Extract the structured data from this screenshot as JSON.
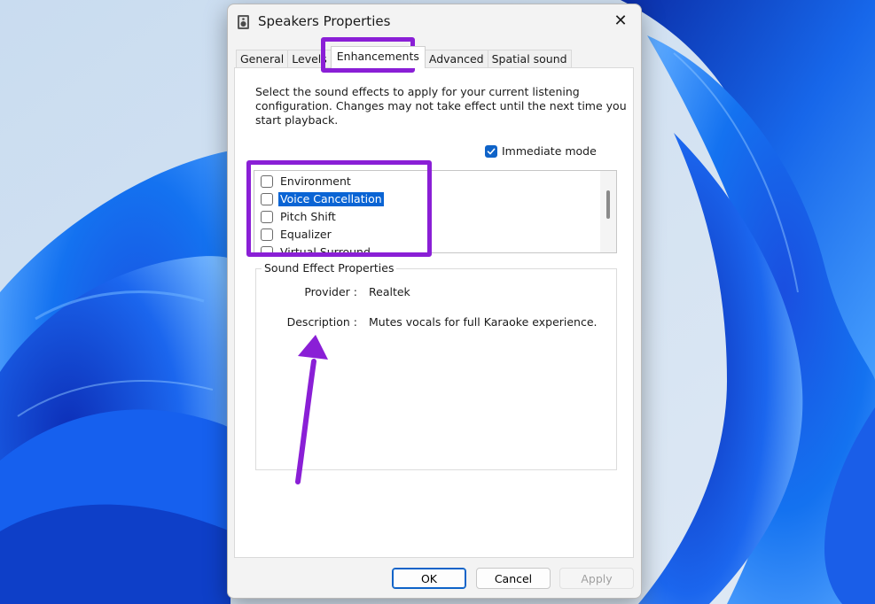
{
  "window": {
    "title": "Speakers Properties",
    "close_glyph": "✕"
  },
  "tabs": [
    {
      "label": "General",
      "active": false
    },
    {
      "label": "Levels",
      "active": false
    },
    {
      "label": "Enhancements",
      "active": true
    },
    {
      "label": "Advanced",
      "active": false
    },
    {
      "label": "Spatial sound",
      "active": false
    }
  ],
  "enhancements": {
    "intro_text": "Select the sound effects to apply for your current listening configuration. Changes may not take effect until the next time you start playback.",
    "immediate_mode": {
      "label": "Immediate mode",
      "checked": true
    },
    "effects": [
      {
        "label": "Environment",
        "checked": false,
        "selected": false
      },
      {
        "label": "Voice Cancellation",
        "checked": false,
        "selected": true
      },
      {
        "label": "Pitch Shift",
        "checked": false,
        "selected": false
      },
      {
        "label": "Equalizer",
        "checked": false,
        "selected": false
      },
      {
        "label": "Virtual Surround",
        "checked": false,
        "selected": false
      }
    ],
    "properties": {
      "group_title": "Sound Effect Properties",
      "provider_label": "Provider :",
      "provider_value": "Realtek",
      "description_label": "Description :",
      "description_value": "Mutes vocals for full Karaoke experience."
    }
  },
  "buttons": {
    "ok": "OK",
    "cancel": "Cancel",
    "apply": "Apply"
  },
  "annotation_color": "#8a1fd6",
  "accent_color": "#0f63c8",
  "icons": {
    "window": "speaker-icon",
    "check": "checkmark-icon"
  }
}
